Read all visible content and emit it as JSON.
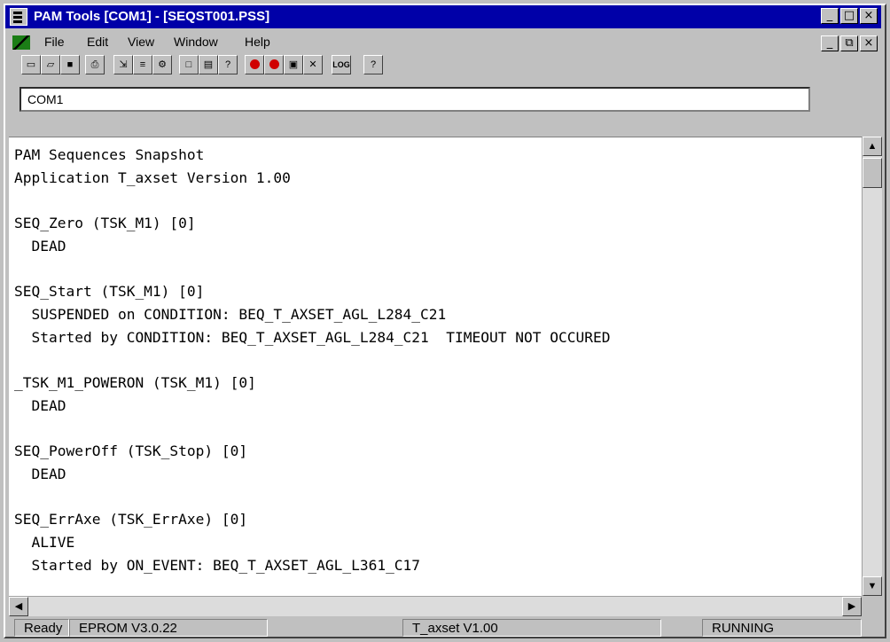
{
  "window": {
    "title": "PAM Tools [COM1] - [SEQST001.PSS]",
    "title_buttons": [
      "_",
      "□",
      "×"
    ],
    "mdi_buttons": [
      "_",
      "⧉",
      "×"
    ]
  },
  "menu": {
    "items": [
      {
        "label": "File"
      },
      {
        "label": "Edit"
      },
      {
        "label": "View"
      },
      {
        "label": "Window"
      },
      {
        "label": "Help"
      }
    ]
  },
  "toolbar": {
    "buttons": [
      {
        "icon": "new-icon"
      },
      {
        "icon": "open-icon"
      },
      {
        "icon": "save-icon"
      },
      {
        "icon": "print-icon"
      },
      {
        "icon": "properties-icon"
      },
      {
        "icon": "list-icon"
      },
      {
        "icon": "tools-icon"
      },
      {
        "icon": "copy-icon"
      },
      {
        "icon": "paste-icon"
      },
      {
        "icon": "help-context-icon"
      },
      {
        "icon": "red-circle-icon"
      },
      {
        "icon": "red-circle-icon"
      },
      {
        "icon": "record-icon"
      },
      {
        "icon": "stop-icon"
      },
      {
        "icon": "log-icon"
      },
      {
        "icon": "question-icon"
      }
    ]
  },
  "port": {
    "value": "COM1"
  },
  "log": {
    "lines": [
      "PAM Sequences Snapshot",
      "Application T_axset Version 1.00",
      "",
      "SEQ_Zero (TSK_M1) [0]",
      "  DEAD",
      "",
      "SEQ_Start (TSK_M1) [0]",
      "  SUSPENDED on CONDITION: BEQ_T_AXSET_AGL_L284_C21",
      "  Started by CONDITION: BEQ_T_AXSET_AGL_L284_C21  TIMEOUT NOT OCCURED",
      "",
      "_TSK_M1_POWERON (TSK_M1) [0]",
      "  DEAD",
      "",
      "SEQ_PowerOff (TSK_Stop) [0]",
      "  DEAD",
      "",
      "SEQ_ErrAxe (TSK_ErrAxe) [0]",
      "  ALIVE",
      "  Started by ON_EVENT: BEQ_T_AXSET_AGL_L361_C17"
    ]
  },
  "status": {
    "ready": "Ready",
    "eprom": "EPROM  V3.0.22",
    "app": "T_axset V1.00",
    "state": "RUNNING"
  }
}
